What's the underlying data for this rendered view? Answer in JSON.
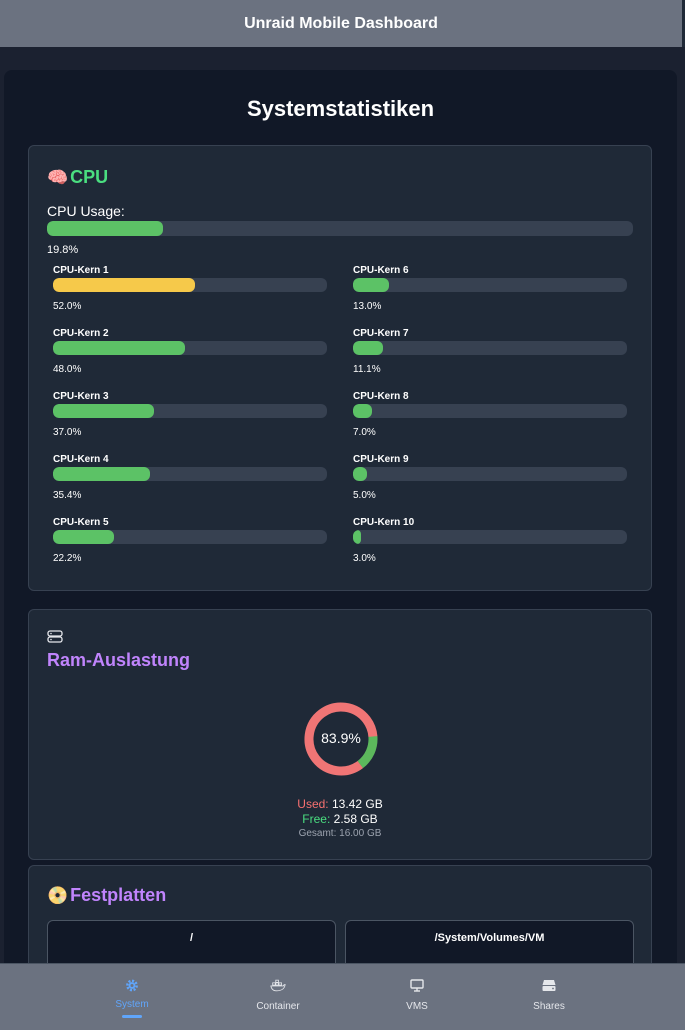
{
  "app": {
    "title": "Unraid Mobile Dashboard"
  },
  "page": {
    "title": "Systemstatistiken"
  },
  "cpu": {
    "title": "CPU",
    "icon": "brain-icon",
    "usage_label": "CPU Usage:",
    "usage_value": "19.8%",
    "usage_fraction": 0.198,
    "cores": [
      {
        "label": "CPU-Kern 1",
        "value": "52.0%",
        "fraction": 0.52,
        "color": "#f6c94a"
      },
      {
        "label": "CPU-Kern 2",
        "value": "48.0%",
        "fraction": 0.48,
        "color": "#5cc266"
      },
      {
        "label": "CPU-Kern 3",
        "value": "37.0%",
        "fraction": 0.37,
        "color": "#5cc266"
      },
      {
        "label": "CPU-Kern 4",
        "value": "35.4%",
        "fraction": 0.354,
        "color": "#5cc266"
      },
      {
        "label": "CPU-Kern 5",
        "value": "22.2%",
        "fraction": 0.222,
        "color": "#5cc266"
      },
      {
        "label": "CPU-Kern 6",
        "value": "13.0%",
        "fraction": 0.13,
        "color": "#5cc266"
      },
      {
        "label": "CPU-Kern 7",
        "value": "11.1%",
        "fraction": 0.111,
        "color": "#5cc266"
      },
      {
        "label": "CPU-Kern 8",
        "value": "7.0%",
        "fraction": 0.07,
        "color": "#5cc266"
      },
      {
        "label": "CPU-Kern 9",
        "value": "5.0%",
        "fraction": 0.05,
        "color": "#5cc266"
      },
      {
        "label": "CPU-Kern 10",
        "value": "3.0%",
        "fraction": 0.03,
        "color": "#5cc266"
      }
    ]
  },
  "ram": {
    "title": "Ram-Auslastung",
    "icon": "server-icon",
    "percent_label": "83.9%",
    "used_fraction": 0.839,
    "used_label": "Used:",
    "used_value": "13.42 GB",
    "free_label": "Free:",
    "free_value": "2.58 GB",
    "total_label": "Gesamt:",
    "total_value": "16.00 GB",
    "used_color": "#f07575",
    "free_color": "#5cb85c"
  },
  "disks": {
    "title": "Festplatten",
    "icon": "disc-icon",
    "items": [
      {
        "name": "/"
      },
      {
        "name": "/System/Volumes/VM"
      }
    ]
  },
  "nav": {
    "items": [
      {
        "label": "System",
        "icon": "gear-icon",
        "active": true
      },
      {
        "label": "Container",
        "icon": "docker-icon",
        "active": false
      },
      {
        "label": "VMS",
        "icon": "monitor-icon",
        "active": false
      },
      {
        "label": "Shares",
        "icon": "server-icon",
        "active": false
      }
    ]
  },
  "colors": {
    "accent": "#60a5fa",
    "cpu_title": "#4ade80",
    "section_title": "#c084fc",
    "bar_green": "#5cc266",
    "bar_yellow": "#f6c94a"
  }
}
